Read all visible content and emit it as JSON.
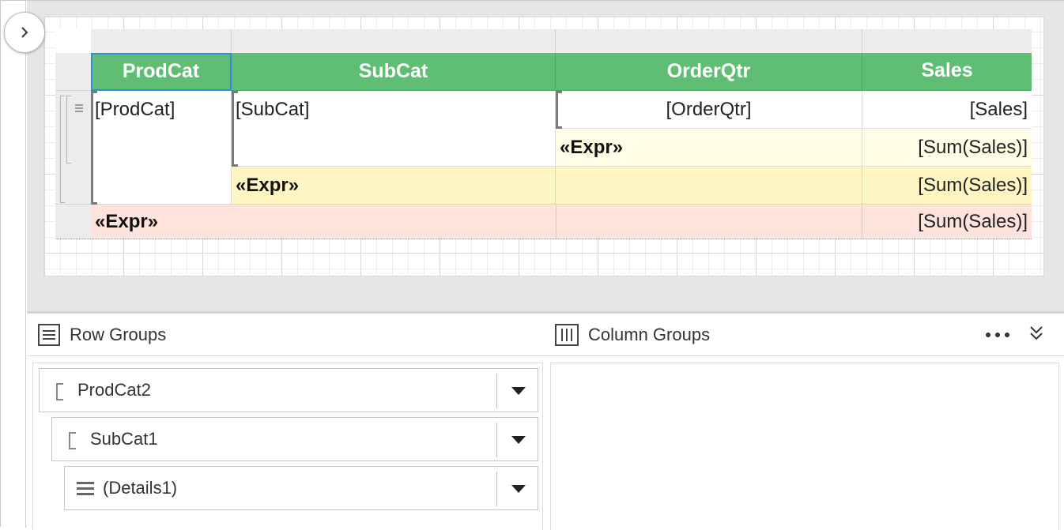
{
  "design": {
    "headers": {
      "prodcat": "ProdCat",
      "subcat": "SubCat",
      "orderqtr": "OrderQtr",
      "sales": "Sales"
    },
    "detail": {
      "prodcat": "[ProdCat]",
      "subcat": "[SubCat]",
      "orderqtr": "[OrderQtr]",
      "sales": "[Sales]"
    },
    "subtotal_orderqtr": {
      "expr": "«Expr»",
      "sum": "[Sum(Sales)]"
    },
    "subtotal_subcat": {
      "expr": "«Expr»",
      "sum": "[Sum(Sales)]"
    },
    "total": {
      "expr": "«Expr»",
      "sum": "[Sum(Sales)]"
    }
  },
  "groups": {
    "row_groups_title": "Row Groups",
    "column_groups_title": "Column Groups",
    "row_groups": [
      {
        "label": "ProdCat2",
        "icon": "group-bracket-icon"
      },
      {
        "label": "SubCat1",
        "icon": "group-bracket-icon"
      },
      {
        "label": "(Details1)",
        "icon": "details-lines-icon"
      }
    ]
  },
  "colors": {
    "header_green": "#5fbe73",
    "subtotal_light_yellow": "#fffde5",
    "subtotal_yellow": "#fff5c2",
    "total_pink": "#fde3dc",
    "selection_blue": "#2f8fd8"
  }
}
